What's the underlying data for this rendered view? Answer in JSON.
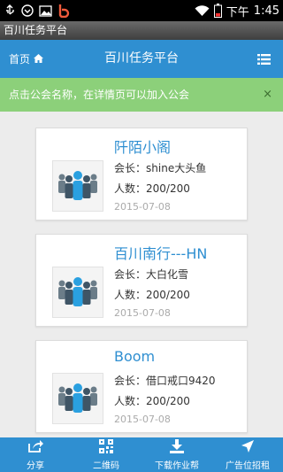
{
  "status_bar": {
    "time_period": "下午",
    "time": "1:45",
    "icons": [
      "usb-icon",
      "notification-icon",
      "image-icon",
      "app-b-icon",
      "wifi-icon",
      "battery-icon"
    ]
  },
  "app_title": "百川任务平台",
  "header": {
    "home_label": "首页",
    "title": "百川任务平台",
    "home_icon": "home-icon",
    "menu_icon": "menu-icon"
  },
  "notice": {
    "text": "点击公会名称，在详情页可以加入公会",
    "close_symbol": "×"
  },
  "guilds": [
    {
      "name": "阡陌小阁",
      "leader_label": "会长：",
      "leader": "shine大头鱼",
      "count_label": "人数：",
      "count": "200/200",
      "date": "2015-07-08"
    },
    {
      "name": "百川南行---HN",
      "leader_label": "会长：",
      "leader": "大白化雪",
      "count_label": "人数：",
      "count": "200/200",
      "date": "2015-07-08"
    },
    {
      "name": "Boom",
      "leader_label": "会长：",
      "leader": "借口戒口9420",
      "count_label": "人数：",
      "count": "200/200",
      "date": "2015-07-08"
    }
  ],
  "tabs": [
    {
      "label": "分享",
      "icon": "share-icon"
    },
    {
      "label": "二维码",
      "icon": "qrcode-icon"
    },
    {
      "label": "下载作业帮",
      "icon": "download-icon"
    },
    {
      "label": "广告位招租",
      "icon": "location-arrow-icon"
    }
  ],
  "colors": {
    "primary": "#2f8fd1",
    "notice_bg": "#8cd07a",
    "guild_name": "#2f8fd1"
  }
}
